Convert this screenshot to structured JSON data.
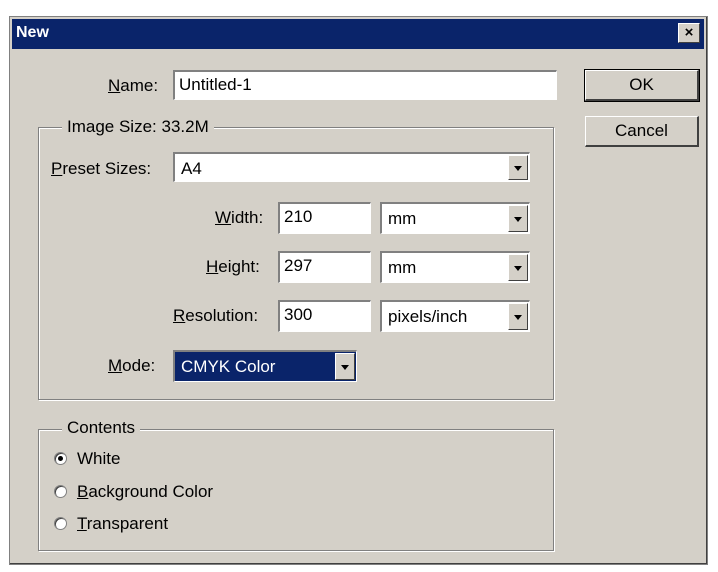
{
  "dialog": {
    "title": "New",
    "close_glyph": "×",
    "ok_label": "OK",
    "cancel_label": "Cancel"
  },
  "name": {
    "label_underline": "N",
    "label_rest": "ame:",
    "value": "Untitled-1"
  },
  "image_size": {
    "group_title": "Image Size: 33.2M",
    "preset": {
      "label_underline": "P",
      "label_rest": "reset Sizes:",
      "value": "A4"
    },
    "width": {
      "label_underline": "W",
      "label_rest": "idth:",
      "value": "210",
      "unit": "mm"
    },
    "height": {
      "label_underline": "H",
      "label_rest": "eight:",
      "value": "297",
      "unit": "mm"
    },
    "resolution": {
      "label_underline": "R",
      "label_rest": "esolution:",
      "value": "300",
      "unit": "pixels/inch"
    },
    "mode": {
      "label_underline": "M",
      "label_rest": "ode:",
      "value": "CMYK Color"
    }
  },
  "contents": {
    "group_title": "Contents",
    "options": [
      {
        "label_underline": "",
        "label_rest": "White",
        "checked": true
      },
      {
        "label_underline": "B",
        "label_rest": "ackground Color",
        "checked": false
      },
      {
        "label_underline": "T",
        "label_rest": "ransparent",
        "checked": false
      }
    ]
  }
}
